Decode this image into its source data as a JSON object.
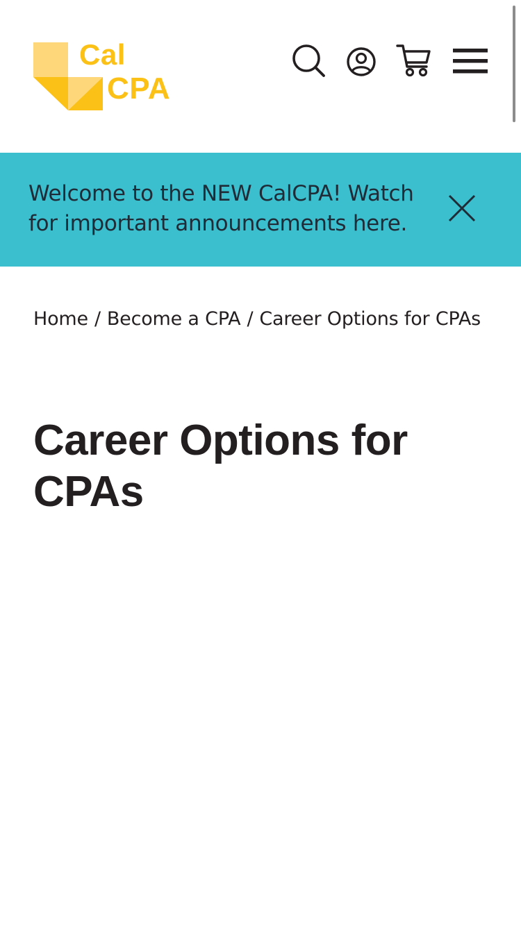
{
  "brand": {
    "logo_line1": "Cal",
    "logo_line2": "CPA",
    "logo_color": "#fcc117",
    "logo_light_color": "#fdd779"
  },
  "header": {
    "icons": [
      "search-icon",
      "account-icon",
      "cart-icon",
      "menu-icon"
    ]
  },
  "banner": {
    "text": "Welcome to the NEW CalCPA! Watch for important announcements here.",
    "background": "#3bbecd",
    "close_icon": "close-icon"
  },
  "breadcrumb": {
    "items": [
      "Home",
      "Become a CPA",
      "Career Options for CPAs"
    ],
    "separator": "/"
  },
  "main": {
    "title": "Career Options for CPAs"
  }
}
